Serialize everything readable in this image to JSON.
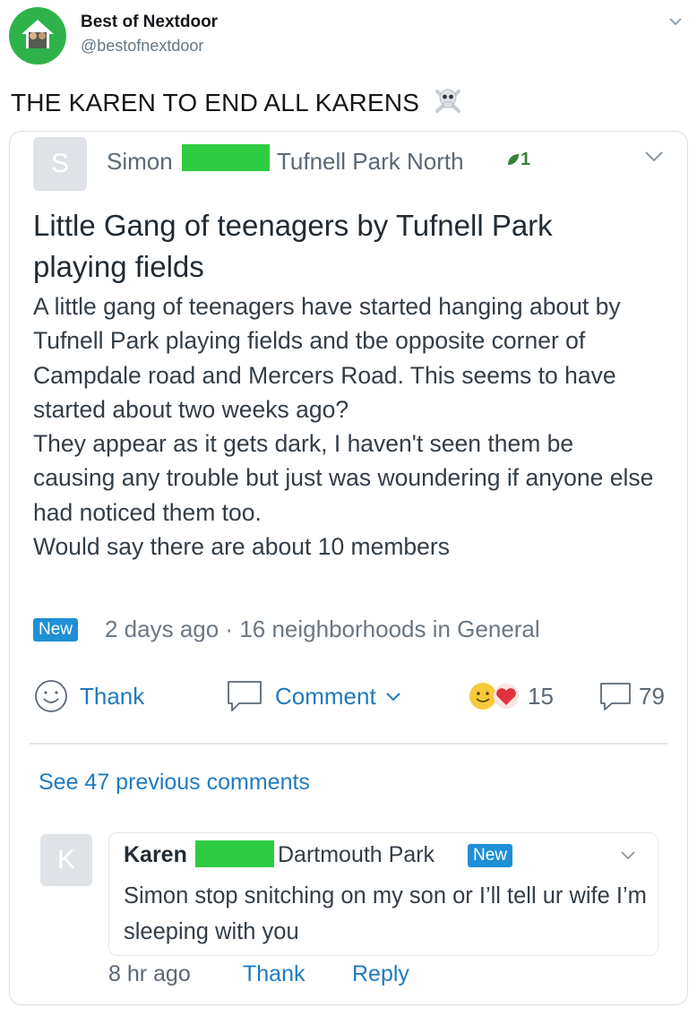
{
  "tweet": {
    "account_name": "Best of Nextdoor",
    "handle": "@bestofnextdoor",
    "text": "THE KAREN TO END ALL KARENS"
  },
  "post": {
    "avatar_letter": "S",
    "author": "Simon",
    "neighborhood": "Tufnell Park North",
    "badge_count": "1",
    "title": "Little Gang of teenagers by Tufnell Park playing fields",
    "body": "A little gang of teenagers have started hanging about by Tufnell Park playing fields and tbe opposite corner of Campdale road and Mercers Road. This seems to have started about two weeks ago?\nThey appear as it gets dark, I haven't seen them be causing any trouble but just was woundering if anyone else had noticed them too.\nWould say there are about 10 members",
    "new_label": "New",
    "meta": "2 days ago · 16 neighborhoods in General",
    "thank_label": "Thank",
    "comment_label": "Comment",
    "reaction_count": "15",
    "comment_count": "79"
  },
  "comments": {
    "see_previous": "See 47 previous comments",
    "reply": {
      "avatar_letter": "K",
      "author": "Karen",
      "neighborhood": "Dartmouth Park",
      "new_label": "New",
      "text": "Simon stop snitching on my son or I’ll tell ur wife I’m sleeping with you",
      "time": "8 hr ago",
      "thank_label": "Thank",
      "reply_label": "Reply"
    }
  },
  "colors": {
    "accent": "#1f7bbf",
    "new_badge": "#1f8fd6",
    "redaction": "#2ecc40",
    "brand_green": "#2db34a"
  },
  "icons": [
    "skull-crossbones-icon",
    "chevron-down-icon",
    "leaf-icon",
    "smiley-icon",
    "speech-bubble-icon",
    "heart-icon"
  ]
}
